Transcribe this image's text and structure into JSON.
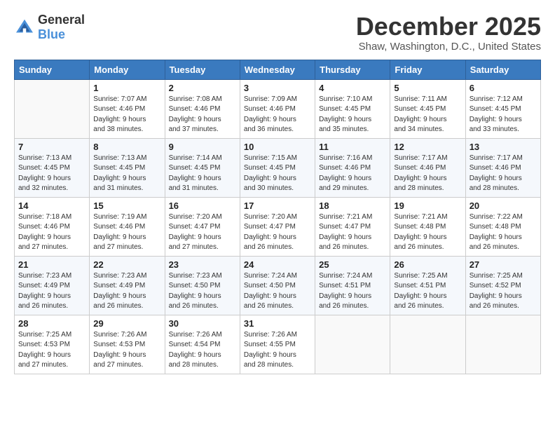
{
  "logo": {
    "general": "General",
    "blue": "Blue"
  },
  "title": {
    "month_year": "December 2025",
    "location": "Shaw, Washington, D.C., United States"
  },
  "days_of_week": [
    "Sunday",
    "Monday",
    "Tuesday",
    "Wednesday",
    "Thursday",
    "Friday",
    "Saturday"
  ],
  "weeks": [
    [
      {
        "day": "",
        "info": ""
      },
      {
        "day": "1",
        "info": "Sunrise: 7:07 AM\nSunset: 4:46 PM\nDaylight: 9 hours\nand 38 minutes."
      },
      {
        "day": "2",
        "info": "Sunrise: 7:08 AM\nSunset: 4:46 PM\nDaylight: 9 hours\nand 37 minutes."
      },
      {
        "day": "3",
        "info": "Sunrise: 7:09 AM\nSunset: 4:46 PM\nDaylight: 9 hours\nand 36 minutes."
      },
      {
        "day": "4",
        "info": "Sunrise: 7:10 AM\nSunset: 4:45 PM\nDaylight: 9 hours\nand 35 minutes."
      },
      {
        "day": "5",
        "info": "Sunrise: 7:11 AM\nSunset: 4:45 PM\nDaylight: 9 hours\nand 34 minutes."
      },
      {
        "day": "6",
        "info": "Sunrise: 7:12 AM\nSunset: 4:45 PM\nDaylight: 9 hours\nand 33 minutes."
      }
    ],
    [
      {
        "day": "7",
        "info": "Sunrise: 7:13 AM\nSunset: 4:45 PM\nDaylight: 9 hours\nand 32 minutes."
      },
      {
        "day": "8",
        "info": "Sunrise: 7:13 AM\nSunset: 4:45 PM\nDaylight: 9 hours\nand 31 minutes."
      },
      {
        "day": "9",
        "info": "Sunrise: 7:14 AM\nSunset: 4:45 PM\nDaylight: 9 hours\nand 31 minutes."
      },
      {
        "day": "10",
        "info": "Sunrise: 7:15 AM\nSunset: 4:45 PM\nDaylight: 9 hours\nand 30 minutes."
      },
      {
        "day": "11",
        "info": "Sunrise: 7:16 AM\nSunset: 4:46 PM\nDaylight: 9 hours\nand 29 minutes."
      },
      {
        "day": "12",
        "info": "Sunrise: 7:17 AM\nSunset: 4:46 PM\nDaylight: 9 hours\nand 28 minutes."
      },
      {
        "day": "13",
        "info": "Sunrise: 7:17 AM\nSunset: 4:46 PM\nDaylight: 9 hours\nand 28 minutes."
      }
    ],
    [
      {
        "day": "14",
        "info": "Sunrise: 7:18 AM\nSunset: 4:46 PM\nDaylight: 9 hours\nand 27 minutes."
      },
      {
        "day": "15",
        "info": "Sunrise: 7:19 AM\nSunset: 4:46 PM\nDaylight: 9 hours\nand 27 minutes."
      },
      {
        "day": "16",
        "info": "Sunrise: 7:20 AM\nSunset: 4:47 PM\nDaylight: 9 hours\nand 27 minutes."
      },
      {
        "day": "17",
        "info": "Sunrise: 7:20 AM\nSunset: 4:47 PM\nDaylight: 9 hours\nand 26 minutes."
      },
      {
        "day": "18",
        "info": "Sunrise: 7:21 AM\nSunset: 4:47 PM\nDaylight: 9 hours\nand 26 minutes."
      },
      {
        "day": "19",
        "info": "Sunrise: 7:21 AM\nSunset: 4:48 PM\nDaylight: 9 hours\nand 26 minutes."
      },
      {
        "day": "20",
        "info": "Sunrise: 7:22 AM\nSunset: 4:48 PM\nDaylight: 9 hours\nand 26 minutes."
      }
    ],
    [
      {
        "day": "21",
        "info": "Sunrise: 7:23 AM\nSunset: 4:49 PM\nDaylight: 9 hours\nand 26 minutes."
      },
      {
        "day": "22",
        "info": "Sunrise: 7:23 AM\nSunset: 4:49 PM\nDaylight: 9 hours\nand 26 minutes."
      },
      {
        "day": "23",
        "info": "Sunrise: 7:23 AM\nSunset: 4:50 PM\nDaylight: 9 hours\nand 26 minutes."
      },
      {
        "day": "24",
        "info": "Sunrise: 7:24 AM\nSunset: 4:50 PM\nDaylight: 9 hours\nand 26 minutes."
      },
      {
        "day": "25",
        "info": "Sunrise: 7:24 AM\nSunset: 4:51 PM\nDaylight: 9 hours\nand 26 minutes."
      },
      {
        "day": "26",
        "info": "Sunrise: 7:25 AM\nSunset: 4:51 PM\nDaylight: 9 hours\nand 26 minutes."
      },
      {
        "day": "27",
        "info": "Sunrise: 7:25 AM\nSunset: 4:52 PM\nDaylight: 9 hours\nand 26 minutes."
      }
    ],
    [
      {
        "day": "28",
        "info": "Sunrise: 7:25 AM\nSunset: 4:53 PM\nDaylight: 9 hours\nand 27 minutes."
      },
      {
        "day": "29",
        "info": "Sunrise: 7:26 AM\nSunset: 4:53 PM\nDaylight: 9 hours\nand 27 minutes."
      },
      {
        "day": "30",
        "info": "Sunrise: 7:26 AM\nSunset: 4:54 PM\nDaylight: 9 hours\nand 28 minutes."
      },
      {
        "day": "31",
        "info": "Sunrise: 7:26 AM\nSunset: 4:55 PM\nDaylight: 9 hours\nand 28 minutes."
      },
      {
        "day": "",
        "info": ""
      },
      {
        "day": "",
        "info": ""
      },
      {
        "day": "",
        "info": ""
      }
    ]
  ]
}
